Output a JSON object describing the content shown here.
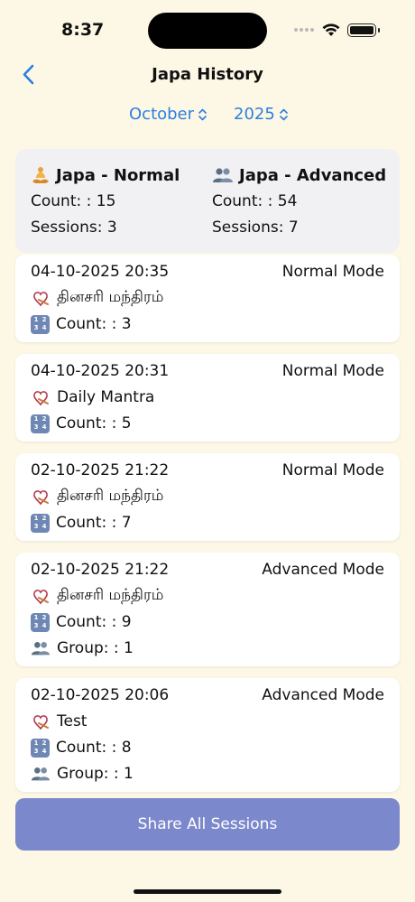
{
  "status": {
    "time": "8:37"
  },
  "nav": {
    "title": "Japa History"
  },
  "filters": {
    "month": "October",
    "year": "2025"
  },
  "summary": {
    "normal": {
      "title": "Japa - Normal",
      "count": "Count: : 15",
      "sessions": "Sessions: 3"
    },
    "advanced": {
      "title": "Japa - Advanced",
      "count": "Count: : 54",
      "sessions": "Sessions: 7"
    }
  },
  "sessions": [
    {
      "datetime": "04-10-2025 20:35",
      "mode": "Normal Mode",
      "mantra": "தினசரி மந்திரம்",
      "count": "Count: : 3"
    },
    {
      "datetime": "04-10-2025 20:31",
      "mode": "Normal Mode",
      "mantra": "Daily Mantra",
      "count": "Count: : 5"
    },
    {
      "datetime": "02-10-2025 21:22",
      "mode": "Normal Mode",
      "mantra": "தினசரி மந்திரம்",
      "count": "Count: : 7"
    },
    {
      "datetime": "02-10-2025 21:22",
      "mode": "Advanced Mode",
      "mantra": "தினசரி மந்திரம்",
      "count": "Count: : 9",
      "group": "Group: : 1"
    },
    {
      "datetime": "02-10-2025 20:06",
      "mode": "Advanced Mode",
      "mantra": "Test",
      "count": "Count: : 8",
      "group": "Group: : 1"
    }
  ],
  "actions": {
    "share_label": "Share All Sessions"
  },
  "icons": {
    "back": "chevron-left-icon",
    "picker": "chevron-up-down-icon",
    "mantra": "mantra-icon",
    "count": "numbers-icon",
    "group": "group-icon"
  },
  "colors": {
    "accent": "#2d7fe0",
    "share_button": "#7c88cc",
    "background": "#fdf8e6"
  }
}
